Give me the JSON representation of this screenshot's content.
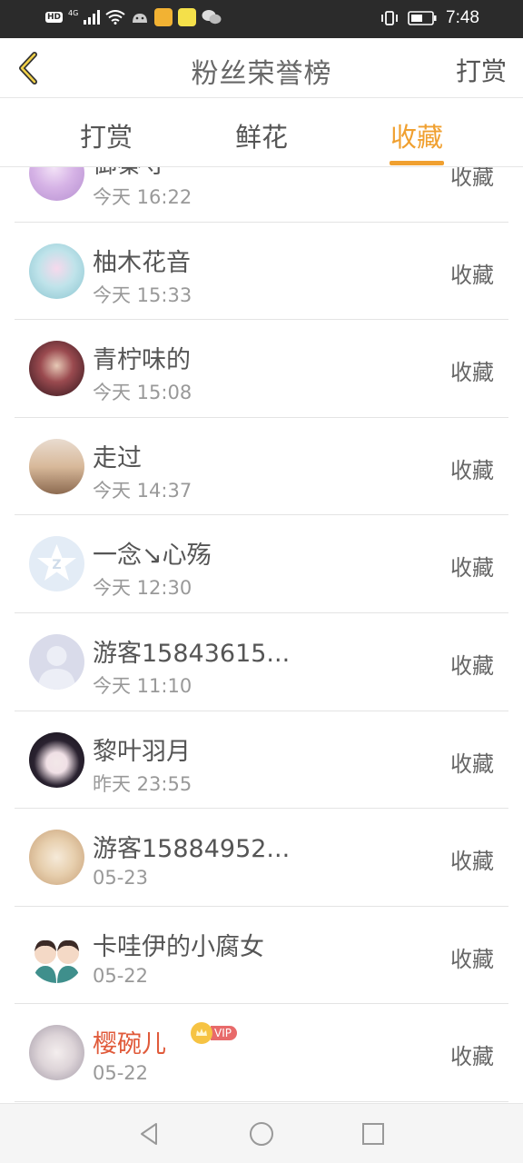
{
  "status_bar": {
    "left_badge": "HD",
    "network": "4G",
    "time": "7:48"
  },
  "header": {
    "title": "粉丝荣誉榜",
    "action_label": "打赏",
    "accent_color": "#f0a030"
  },
  "tabs": [
    {
      "label": "打赏",
      "active": false
    },
    {
      "label": "鲜花",
      "active": false
    },
    {
      "label": "收藏",
      "active": true
    }
  ],
  "list": [
    {
      "name": "御秦寻",
      "time": "今天 16:22",
      "action": "收藏",
      "avatar": "purple-hair-anime"
    },
    {
      "name": "柚木花音",
      "time": "今天 15:33",
      "action": "收藏",
      "avatar": "pastel-anime"
    },
    {
      "name": "青柠味的",
      "time": "今天 15:08",
      "action": "收藏",
      "avatar": "dark-dress-anime"
    },
    {
      "name": "走过",
      "time": "今天 14:37",
      "action": "收藏",
      "avatar": "sunset-silhouette"
    },
    {
      "name": "一念↘心殇",
      "time": "今天 12:30",
      "action": "收藏",
      "avatar": "qzone-star"
    },
    {
      "name": "游客15843615...",
      "time": "今天 11:10",
      "action": "收藏",
      "avatar": "default-person"
    },
    {
      "name": "黎叶羽月",
      "time": "昨天 23:55",
      "action": "收藏",
      "avatar": "dark-hair-girl"
    },
    {
      "name": "游客15884952...",
      "time": "05-23",
      "action": "收藏",
      "avatar": "sepia-anime"
    },
    {
      "name": "卡哇伊的小腐女",
      "time": "05-22",
      "action": "收藏",
      "avatar": "two-boys-anime"
    },
    {
      "name": "樱碗儿",
      "time": "05-22",
      "action": "收藏",
      "avatar": "white-hair-girl",
      "vip": true,
      "vip_label": "VIP"
    }
  ]
}
